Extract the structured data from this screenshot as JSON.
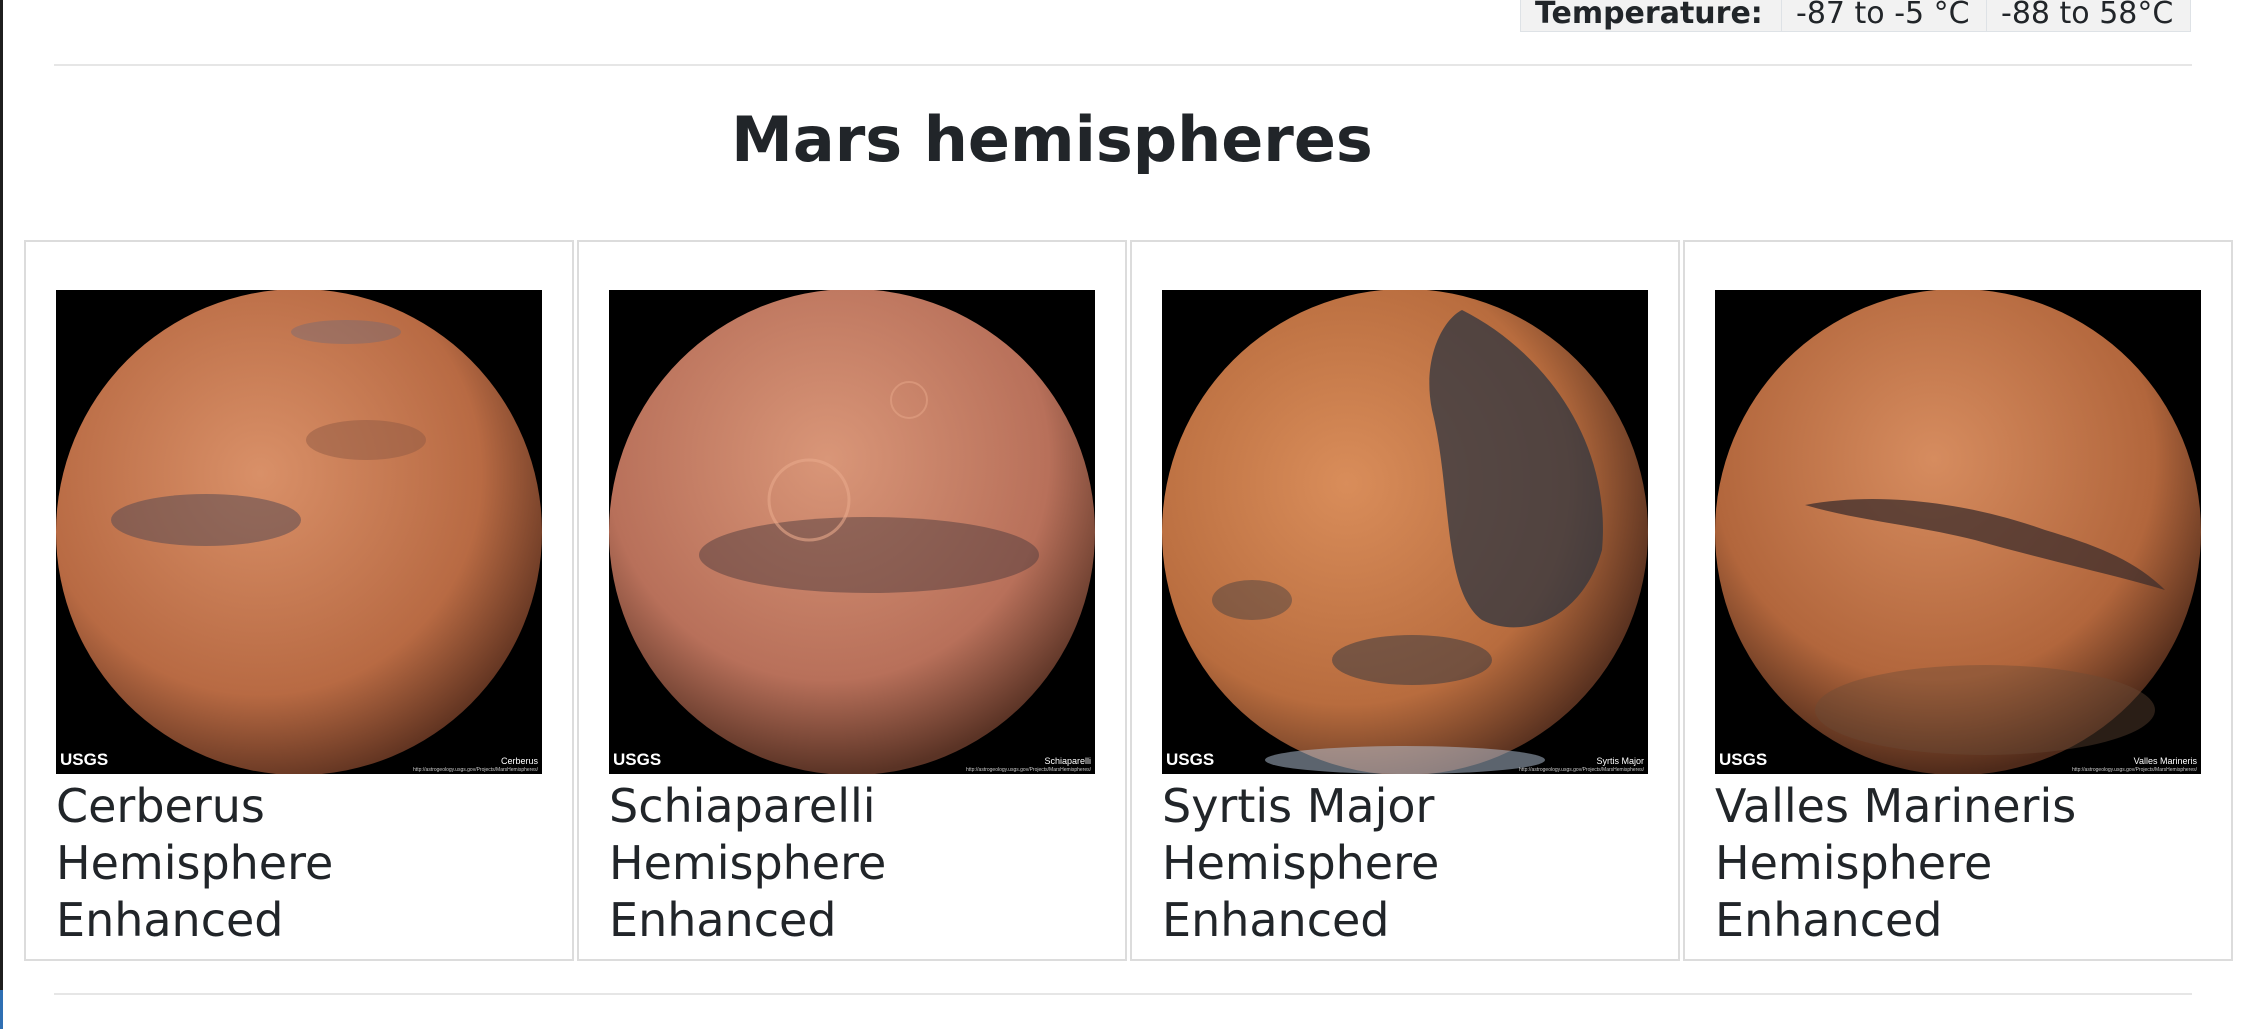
{
  "facts": {
    "label": "Temperature:",
    "col1": "-87 to -5 °C",
    "col2": "-88 to 58°C"
  },
  "section_title": "Mars hemispheres",
  "hemispheres": [
    {
      "title": "Cerberus Hemisphere Enhanced",
      "image_label": "Cerberus",
      "logo": "USGS",
      "url": "http://astrogeology.usgs.gov/Projects/MarsHemispheres/",
      "base_color": "#c2764f",
      "dark_color": "#5a4a52"
    },
    {
      "title": "Schiaparelli Hemisphere Enhanced",
      "image_label": "Schiaparelli",
      "logo": "USGS",
      "url": "http://astrogeology.usgs.gov/Projects/MarsHemispheres/",
      "base_color": "#c47a60",
      "dark_color": "#4f3b3d"
    },
    {
      "title": "Syrtis Major Hemisphere Enhanced",
      "image_label": "Syrtis Major",
      "logo": "USGS",
      "url": "http://astrogeology.usgs.gov/Projects/MarsHemispheres/",
      "base_color": "#c5784b",
      "dark_color": "#2f3640"
    },
    {
      "title": "Valles Marineris Hemisphere Enhanced",
      "image_label": "Valles Marineris",
      "logo": "USGS",
      "url": "http://astrogeology.usgs.gov/Projects/MarsHemispheres/",
      "base_color": "#c07048",
      "dark_color": "#3d2e2c"
    }
  ]
}
